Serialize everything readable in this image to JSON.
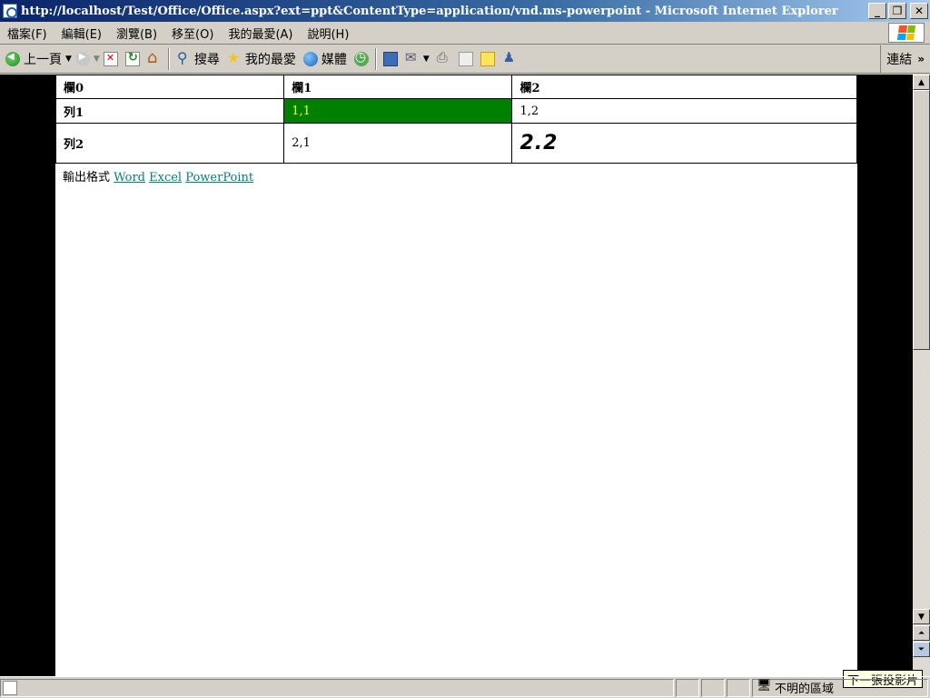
{
  "window": {
    "title": "http://localhost/Test/Office/Office.aspx?ext=ppt&ContentType=application/vnd.ms-powerpoint - Microsoft Internet Explorer",
    "minimize": "_",
    "restore": "❐",
    "close": "✕"
  },
  "menubar": {
    "items": [
      "檔案(F)",
      "編輯(E)",
      "瀏覽(B)",
      "移至(O)",
      "我的最愛(A)",
      "說明(H)"
    ]
  },
  "toolbar": {
    "back_label": "上一頁",
    "search_label": "搜尋",
    "favorites_label": "我的最愛",
    "media_label": "媒體",
    "links_label": "連結",
    "links_chevron": "»"
  },
  "table": {
    "headers": [
      "欄0",
      "欄1",
      "欄2"
    ],
    "rows": [
      [
        "列1",
        "1,1",
        "1,2"
      ],
      [
        "列2",
        "2,1",
        "2.2"
      ]
    ],
    "highlight_color": "#008000",
    "highlight_text_color": "#ffff00"
  },
  "export": {
    "label": "輸出格式",
    "links": [
      "Word",
      "Excel",
      "PowerPoint"
    ],
    "link_color": "#008080"
  },
  "tooltip": {
    "text": "下一張投影片"
  },
  "statusbar": {
    "zone_text": "不明的區域"
  }
}
